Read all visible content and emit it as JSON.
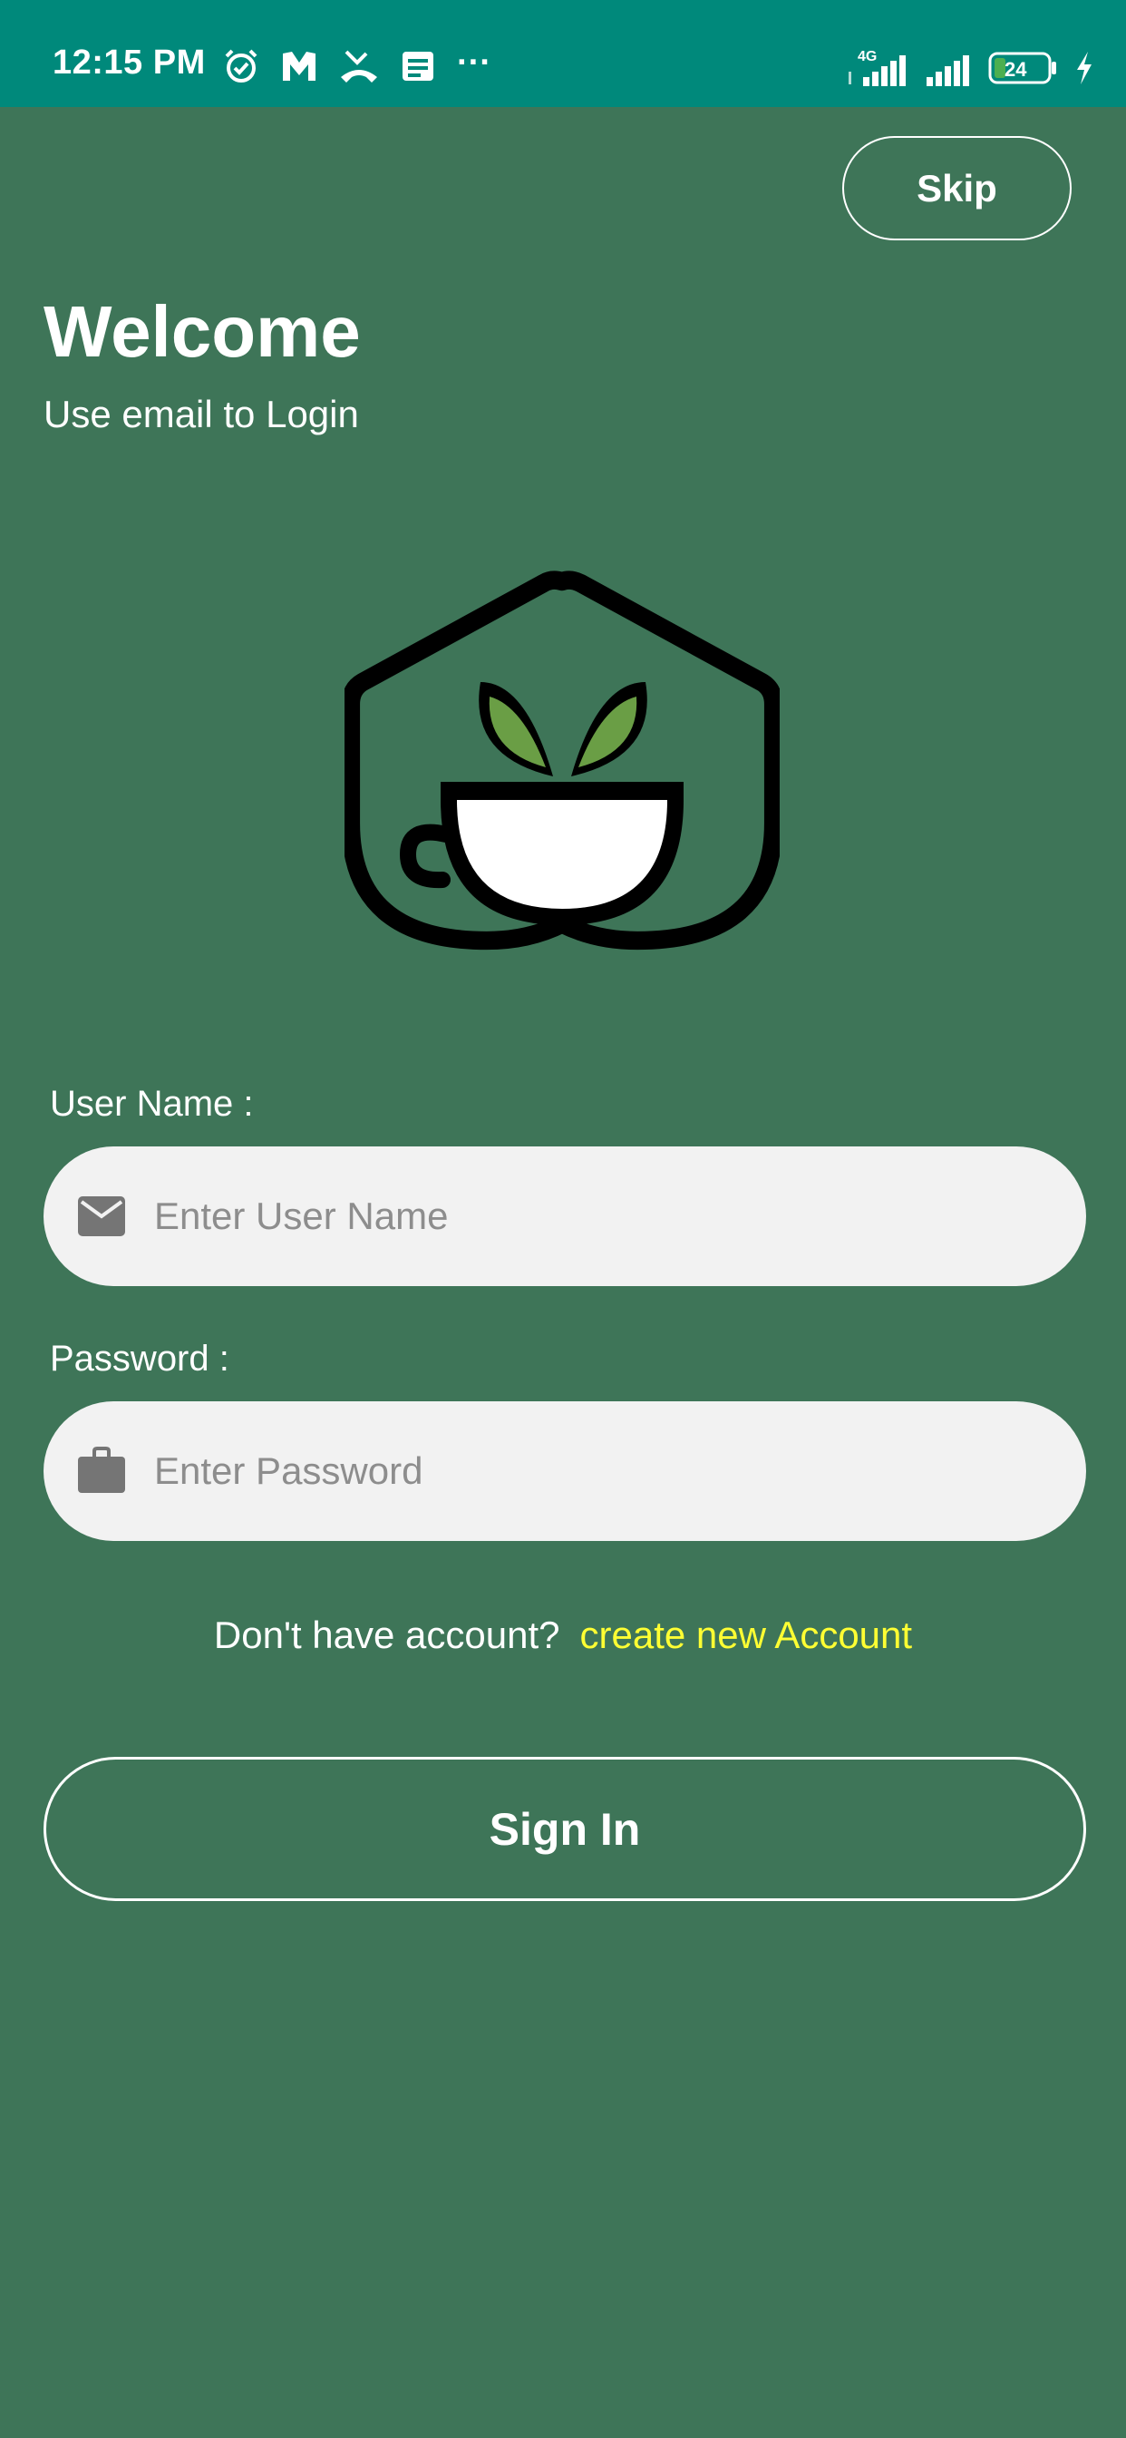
{
  "status_bar": {
    "time": "12:15 PM",
    "more": "···",
    "network": "4G",
    "battery": "24",
    "left_icons": [
      "alarm-icon",
      "m-app-icon",
      "missed-call-icon",
      "message-icon"
    ],
    "right_icons": [
      "signal-4g-icon",
      "signal-icon",
      "battery-icon",
      "charging-icon"
    ]
  },
  "header": {
    "skip_label": "Skip",
    "title": "Welcome",
    "subtitle": "Use email to Login"
  },
  "logo": {
    "icon": "tea-house-logo",
    "colors": {
      "outline": "#000000",
      "leaves": "#6a9e45",
      "cup": "#ffffff"
    }
  },
  "form": {
    "username_label": "User Name :",
    "username_placeholder": "Enter User Name",
    "username_icon": "envelope-icon",
    "password_label": "Password :",
    "password_placeholder": "Enter Password",
    "password_icon": "briefcase-icon"
  },
  "signup": {
    "prompt": "Don't have account?",
    "link": "create new Account"
  },
  "signin_label": "Sign In",
  "colors": {
    "status_bar": "#00897b",
    "background": "#3e7558",
    "input_bg": "#f2f2f2",
    "link": "#ffff33",
    "icon_gray": "#757575"
  }
}
